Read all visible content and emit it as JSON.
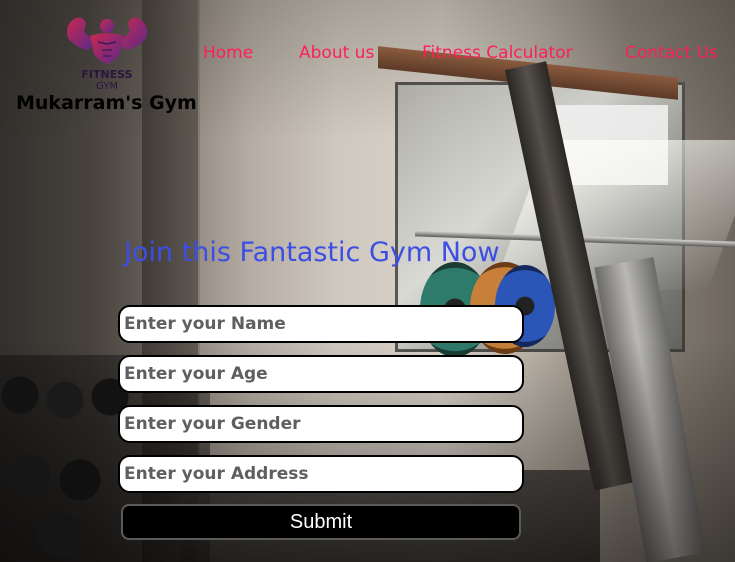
{
  "header": {
    "logo": {
      "icon": "flexing-bodybuilder-icon",
      "text_line1": "FITNESS",
      "text_line2": "GYM"
    },
    "brand_name": "Mukarram's Gym"
  },
  "nav": {
    "items": [
      {
        "label": "Home"
      },
      {
        "label": "About us"
      },
      {
        "label": "Fitness Calculator"
      },
      {
        "label": "Contact Us"
      }
    ],
    "color": "#ff1e56"
  },
  "form": {
    "headline": "Join this Fantastic Gym Now",
    "headline_color": "#3c4ee6",
    "fields": [
      {
        "placeholder": "Enter your Name",
        "value": ""
      },
      {
        "placeholder": "Enter your Age",
        "value": ""
      },
      {
        "placeholder": "Enter your Gender",
        "value": ""
      },
      {
        "placeholder": "Enter your Address",
        "value": ""
      }
    ],
    "submit_label": "Submit"
  }
}
